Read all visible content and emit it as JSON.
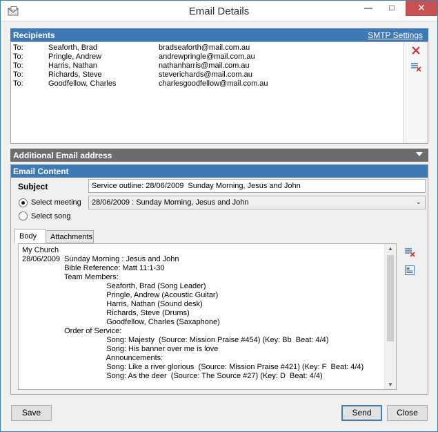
{
  "window": {
    "title": "Email Details"
  },
  "recipients": {
    "header": "Recipients",
    "smtp_link": "SMTP Settings",
    "rows": [
      {
        "type": "To:",
        "name": "Seaforth, Brad",
        "email": "bradseaforth@mail.com.au"
      },
      {
        "type": "To:",
        "name": "Pringle, Andrew",
        "email": "andrewpringle@mail.com.au"
      },
      {
        "type": "To:",
        "name": "Harris, Nathan",
        "email": "nathanharris@mail.com.au"
      },
      {
        "type": "To:",
        "name": "Richards, Steve",
        "email": "steverichards@mail.com.au"
      },
      {
        "type": "To:",
        "name": "Goodfellow, Charles",
        "email": "charlesgoodfellow@mail.com.au"
      }
    ]
  },
  "additional": {
    "header": "Additional Email address"
  },
  "content": {
    "header": "Email Content",
    "subject_label": "Subject",
    "subject_value": "Service outline: 28/06/2009  Sunday Morning, Jesus and John",
    "select_meeting_label": "Select meeting",
    "select_song_label": "Select song",
    "meeting_value": "28/06/2009 : Sunday Morning, Jesus and John",
    "tabs": [
      "Body",
      "Attachments"
    ],
    "body_lines": [
      "My Church",
      "28/06/2009  Sunday Morning : Jesus and John",
      "                    Bible Reference: Matt 11:1-30",
      "                    Team Members:",
      "                                        Seaforth, Brad (Song Leader)",
      "                                        Pringle, Andrew (Acoustic Guitar)",
      "                                        Harris, Nathan (Sound desk)",
      "                                        Richards, Steve (Drums)",
      "                                        Goodfellow, Charles (Saxaphone)",
      "                    Order of Service:",
      "                                        Song: Majesty  (Source: Mission Praise #454) (Key: Bb  Beat: 4/4)",
      "                                        Song: His banner over me is love",
      "                                        Announcements:",
      "                                        Song: Like a river glorious  (Source: Mission Praise #421) (Key: F  Beat: 4/4)",
      "                                        Song: As the deer  (Source: The Source #27) (Key: D  Beat: 4/4)"
    ]
  },
  "buttons": {
    "save": "Save",
    "send": "Send",
    "close": "Close"
  },
  "colors": {
    "panel_header": "#3d79b7",
    "collapsed_header": "#6d6d6d",
    "close_button": "#c75050"
  }
}
